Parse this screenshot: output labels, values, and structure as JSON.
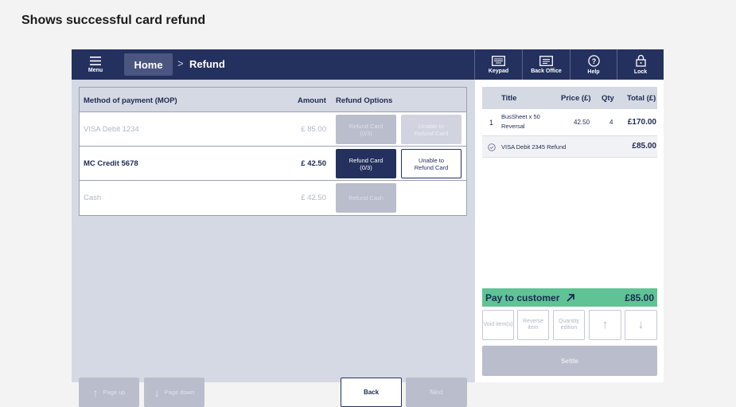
{
  "caption": "Shows successful card refund",
  "topbar": {
    "menu_label": "Menu",
    "home_label": "Home",
    "breadcrumb_separator": ">",
    "current_page": "Refund",
    "buttons": [
      {
        "label": "Keypad",
        "icon": "keypad-icon"
      },
      {
        "label": "Back Office",
        "icon": "back-office-icon"
      },
      {
        "label": "Help",
        "icon": "help-icon"
      },
      {
        "label": "Lock",
        "icon": "lock-icon"
      }
    ]
  },
  "mop_table": {
    "headers": {
      "method": "Method of payment (MOP)",
      "amount": "Amount",
      "options": "Refund Options"
    },
    "rows": [
      {
        "name": "VISA Debit 1234",
        "amount": "£ 85.00",
        "refund_label": "Refund Card\n(0/3)",
        "unable_label": "Unable to\nRefund Card",
        "state": "dim"
      },
      {
        "name": "MC Credit 5678",
        "amount": "£ 42.50",
        "refund_label": "Refund Card\n(0/3)",
        "unable_label": "Unable to\nRefund Card",
        "state": "active"
      },
      {
        "name": "Cash",
        "amount": "£ 42.50",
        "refund_label": "Refund Cash",
        "state": "dim"
      }
    ]
  },
  "pagination": {
    "page_up": "Page up",
    "page_down": "Page down"
  },
  "navigation": {
    "back": "Back",
    "next": "Next"
  },
  "basket": {
    "headers": {
      "title": "Title",
      "price": "Price (£)",
      "qty": "Qty",
      "total": "Total (£)"
    },
    "item": {
      "index": "1",
      "title": "BusSheet x 50 Reversal",
      "price": "42.50",
      "qty": "4",
      "total": "£170.00"
    },
    "refund": {
      "label": "VISA Debit 2345 Refund",
      "amount": "£85.00"
    }
  },
  "pay_bar": {
    "label": "Pay to customer",
    "amount": "£85.00",
    "color": "#5fc395"
  },
  "actions": {
    "void": "Void item(s)",
    "reverse": "Reverse item",
    "quantity": "Quantity edition",
    "up": "↑",
    "down": "↓"
  },
  "settle": "Settle",
  "colors": {
    "navy": "#24315e",
    "panel": "#d5d9e3",
    "disabled": "#b9bdcc",
    "green": "#5fc395"
  }
}
